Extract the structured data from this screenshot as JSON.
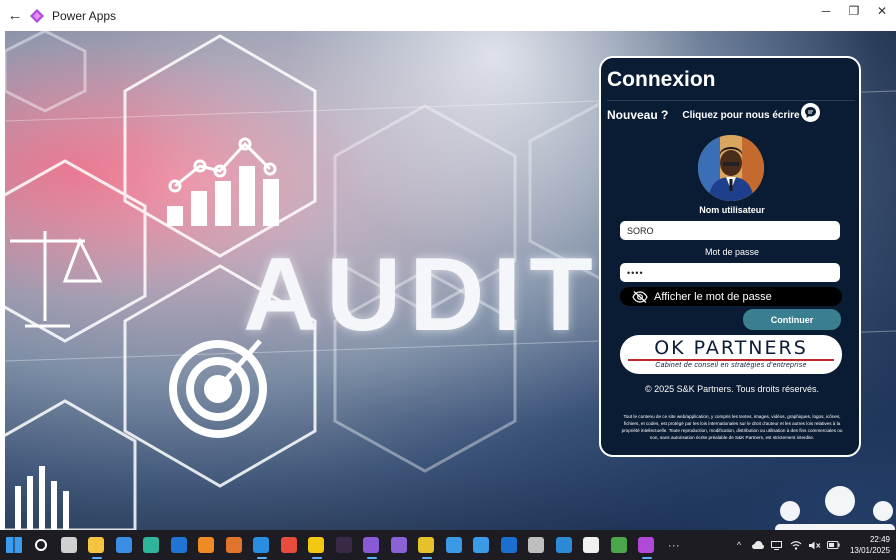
{
  "window": {
    "title": "Power Apps",
    "controls": {
      "minimize": "─",
      "restore": "❐",
      "close": "✕"
    }
  },
  "background": {
    "headline": "AUDIT"
  },
  "login": {
    "title": "Connexion",
    "new_label": "Nouveau ?",
    "contact_link": "Cliquez pour nous écrire",
    "username_label": "Nom utilisateur",
    "username_value": "SORO",
    "password_label": "Mot de passe",
    "password_value": "••••",
    "show_password_label": "Afficher le mot de passe",
    "continue_label": "Continuer",
    "logo_main": "OK PARTNERS",
    "logo_sub": "Cabinet de conseil en stratégies d'entreprise",
    "copyright": "© 2025 S&K Partners. Tous droits réservés.",
    "legal_text": "Tout le contenu de ce site web/application, y compris les textes, images, vidéos, graphiques, logos, icônes, fichiers, et codes, est protégé par les lois internationales sur le droit d'auteur et les autres lois relatives à la propriété intellectuelle. Toute reproduction, modification, distribution ou utilisation à des fins commerciales ou non, sans autorisation écrite préalable de S&K Partners, est strictement interdite."
  },
  "colors": {
    "card_bg": "#0a1c33",
    "continue_bg": "#3a7f8f",
    "logo_accent": "#c0282d",
    "taskbar_bg": "#1c1c22"
  },
  "taskbar": {
    "items": [
      {
        "name": "windows-start-icon",
        "color": "#3b9cf0"
      },
      {
        "name": "search-icon",
        "color": "#ffffff"
      },
      {
        "name": "task-view-icon",
        "color": "#d0d0d0"
      },
      {
        "name": "file-explorer-icon",
        "color": "#f5c542"
      },
      {
        "name": "microsoft-store-icon",
        "color": "#3a8ee6"
      },
      {
        "name": "sway-icon",
        "color": "#2fb59a"
      },
      {
        "name": "outlook-icon",
        "color": "#1f74d4"
      },
      {
        "name": "xampp-icon",
        "color": "#f08a24"
      },
      {
        "name": "matlab-icon",
        "color": "#e0742a"
      },
      {
        "name": "vscode-icon",
        "color": "#2a8ee0"
      },
      {
        "name": "color-app-icon",
        "color": "#e84c3d"
      },
      {
        "name": "powerbi-icon",
        "color": "#f2c811"
      },
      {
        "name": "terminal-app-icon",
        "color": "#3a2a4a"
      },
      {
        "name": "media-app-icon",
        "color": "#8a5ad6"
      },
      {
        "name": "visual-studio-icon",
        "color": "#8a62d6"
      },
      {
        "name": "chrome-icon",
        "color": "#e6c22a"
      },
      {
        "name": "onedrive-sync-icon",
        "color": "#3a9ae6"
      },
      {
        "name": "cloud-app-icon",
        "color": "#3a9ae6"
      },
      {
        "name": "azure-app-icon",
        "color": "#1a6fd0"
      },
      {
        "name": "clock-app-icon",
        "color": "#bfbfbf"
      },
      {
        "name": "split-app-icon",
        "color": "#2a8ad6"
      },
      {
        "name": "capcut-icon",
        "color": "#f0f0f0"
      },
      {
        "name": "image-app-icon",
        "color": "#4aa84a"
      },
      {
        "name": "power-apps-icon",
        "color": "#b04ad6"
      },
      {
        "name": "more-apps-icon",
        "color": "#d0d0d0"
      }
    ],
    "tray": {
      "chevron": "^",
      "time": "22:49",
      "date": "13/01/2025"
    }
  }
}
